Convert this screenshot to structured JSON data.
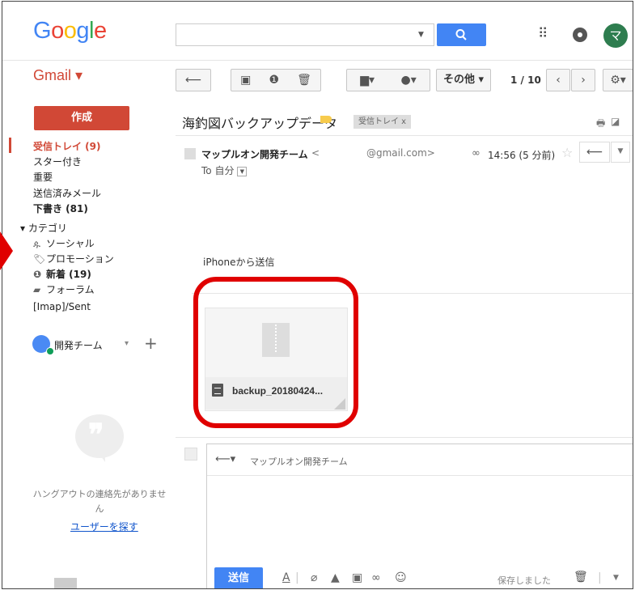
{
  "header": {
    "logo": "Google",
    "logo_colors": [
      "#4285f4",
      "#ea4335",
      "#fbbc05",
      "#4285f4",
      "#34a853",
      "#ea4335"
    ],
    "avatar_letter": "マ"
  },
  "toolbar": {
    "gmail_label": "Gmail ▾",
    "back": "⟵",
    "archive": "▣",
    "spam": "❶",
    "delete": "🗑",
    "move": "▆▾",
    "labels": "●▾",
    "more": "その他 ▾",
    "pager": "1 / 10",
    "prev": "‹",
    "next": "›",
    "settings": "⚙▾"
  },
  "sidebar": {
    "compose": "作成",
    "items": [
      {
        "label": "受信トレイ (9)",
        "style": "inbox"
      },
      {
        "label": "スター付き",
        "style": ""
      },
      {
        "label": "重要",
        "style": ""
      },
      {
        "label": "送信済みメール",
        "style": ""
      },
      {
        "label": "下書き (81)",
        "style": "bold"
      }
    ],
    "categories_label": "▾ カテゴリ",
    "categories": [
      {
        "icon": "ዹ",
        "label": "ソーシャル",
        "bold": false
      },
      {
        "icon": "🏷",
        "label": "プロモーション",
        "bold": false
      },
      {
        "icon": "❶",
        "label": "新着 (19)",
        "bold": true
      },
      {
        "icon": "▰",
        "label": "フォーラム",
        "bold": false
      }
    ],
    "imap_sent": "[Imap]/Sent",
    "team": "開発チーム",
    "hangouts_text": "ハングアウトの連絡先がありません",
    "hangouts_link": "ユーザーを探す"
  },
  "message": {
    "subject": "海釣図バックアップデータ",
    "inbox_chip": "受信トレイ x",
    "sender": "マップルオン開発チーム",
    "sender_lt": "<",
    "email": "@gmail.com>",
    "time": "14:56 (5 分前)",
    "to": "To 自分",
    "body": "iPhoneから送信",
    "attachment": "backup_20180424..."
  },
  "reply": {
    "to": "マップルオン開発チーム",
    "send": "送信",
    "saved": "保存しました"
  },
  "colors": {
    "gmail_red": "#d14836",
    "primary_blue": "#4285f4",
    "highlight_red": "#e00000"
  }
}
